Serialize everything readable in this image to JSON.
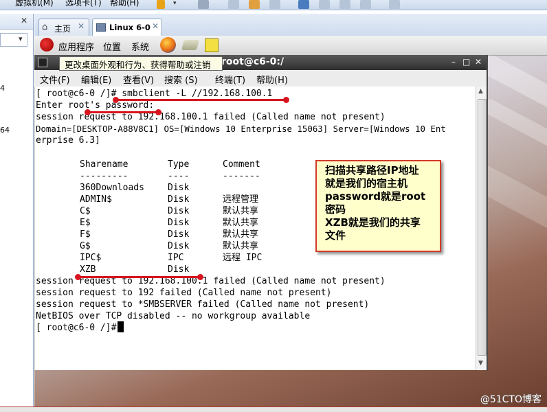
{
  "vm_menu": {
    "items": [
      "虚拟机(M)",
      "选项卡(T)",
      "帮助(H)"
    ]
  },
  "left_panel": {
    "close": "✕",
    "combo_arrow": "▾",
    "numbers": [
      "4",
      "64"
    ]
  },
  "tabs": [
    {
      "label": "主页",
      "close": "✕"
    },
    {
      "label": "Linux 6-0",
      "close": "✕"
    }
  ],
  "gnome_panel": {
    "applications": "应用程序",
    "places": "位置",
    "system": "系统"
  },
  "tooltip": "更改桌面外观和行为、获得帮助或注销",
  "terminal": {
    "title": "root@c6-0:/",
    "menu": [
      "文件(F)",
      "编辑(E)",
      "查看(V)",
      "搜索 (S)",
      "终端(T)",
      "帮助(H)"
    ],
    "lines": [
      "[ root@c6-0 /]# smbclient -L //192.168.100.1",
      "Enter root's password:",
      "session request to 192.168.100.1 failed (Called name not present)",
      "Domain=[DESKTOP-A88V8C1] OS=[Windows 10 Enterprise 15063] Server=[Windows 10 Ent",
      "erprise 6.3]"
    ],
    "share_headers": {
      "name": "Sharename",
      "type": "Type",
      "comment": "Comment"
    },
    "share_sep": {
      "name": "---------",
      "type": "----",
      "comment": "-------"
    },
    "shares": [
      {
        "name": "360Downloads",
        "type": "Disk",
        "comment": ""
      },
      {
        "name": "ADMIN$",
        "type": "Disk",
        "comment": "远程管理"
      },
      {
        "name": "C$",
        "type": "Disk",
        "comment": "默认共享"
      },
      {
        "name": "E$",
        "type": "Disk",
        "comment": "默认共享"
      },
      {
        "name": "F$",
        "type": "Disk",
        "comment": "默认共享"
      },
      {
        "name": "G$",
        "type": "Disk",
        "comment": "默认共享"
      },
      {
        "name": "IPC$",
        "type": "IPC",
        "comment": "远程 IPC"
      },
      {
        "name": "XZB",
        "type": "Disk",
        "comment": ""
      }
    ],
    "tail_lines": [
      "session request to 192.168.100.1 failed (Called name not present)",
      "session request to 192 failed (Called name not present)",
      "session request to *SMBSERVER failed (Called name not present)",
      "NetBIOS over TCP disabled -- no workgroup available",
      "[ root@c6-0 /]# "
    ]
  },
  "callout": {
    "lines": [
      "扫描共享路径IP地址",
      "就是我们的宿主机",
      "password就是root",
      "密码",
      "XZB就是我们的共享",
      "文件"
    ]
  },
  "watermark": "@51CTO博客",
  "colors": {
    "annotation_red": "#d8141e",
    "callout_bg": "#ffffcc",
    "callout_border": "#d33a2a"
  }
}
